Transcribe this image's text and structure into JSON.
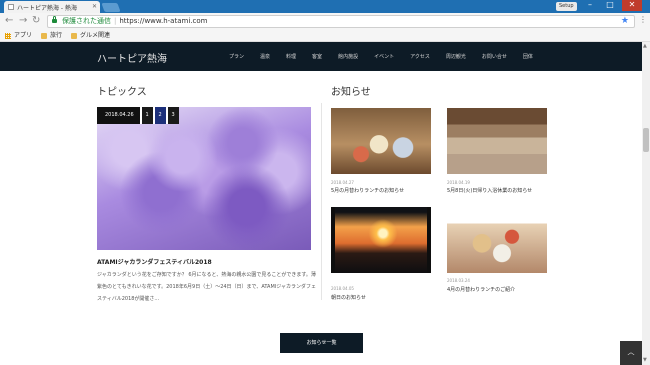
{
  "browser": {
    "tab_title": "ハートピア熱海 - 熱海",
    "user_button": "Setup",
    "secure_label": "保護された通信",
    "url": "https://www.h-atami.com",
    "bookmarks": [
      {
        "label": "アプリ",
        "icon": "apps-icon"
      },
      {
        "label": "旅行",
        "icon": "folder-icon"
      },
      {
        "label": "グルメ関連",
        "icon": "folder-icon"
      }
    ]
  },
  "site": {
    "logo": "ハートピア熱海",
    "nav": [
      "プラン",
      "温泉",
      "料理",
      "客室",
      "館内施設",
      "イベント",
      "アクセス",
      "周辺観光",
      "お問い合せ",
      "団体"
    ]
  },
  "topics": {
    "title": "トピックス",
    "slide_date": "2018.04.26",
    "slide_dots": [
      "1",
      "2",
      "3"
    ],
    "heading": "ATAMIジャカランダフェスティバル2018",
    "text": "ジャカランダという花をご存知ですか？ 6月になると、熱海の親水公園で見ることができます。薄紫色のとてもきれいな花です。2018年6月9日（土）〜24日（日）まで、ATAMIジャカランダフェスティバル2018が開催さ..."
  },
  "news": {
    "title": "お知らせ",
    "items": [
      {
        "date": "2018.04.27",
        "title": "5月の月替わりランチのお知らせ"
      },
      {
        "date": "2018.04.19",
        "title": "5月8日(火)日帰り入浴休業のお知らせ"
      },
      {
        "date": "2018.04.05",
        "title": "朝日のお知らせ"
      },
      {
        "date": "2018.03.24",
        "title": "4月の月替わりランチのご紹介"
      }
    ],
    "more_label": "お知らせ一覧"
  }
}
